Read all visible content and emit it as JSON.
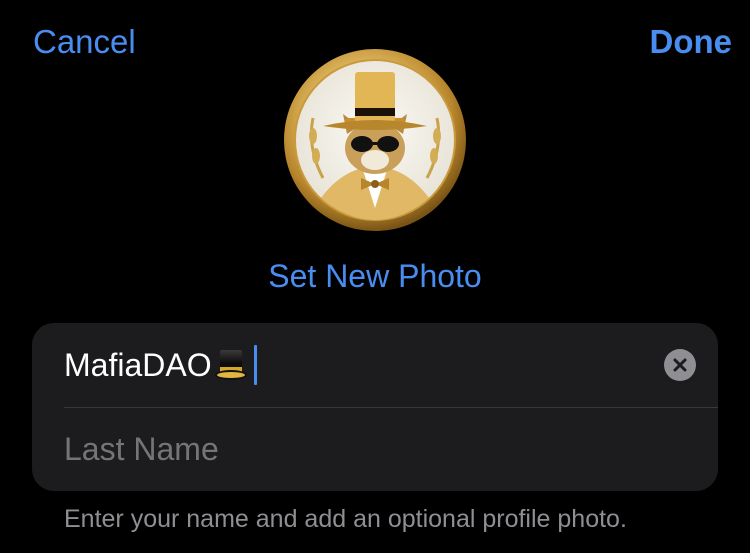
{
  "nav": {
    "cancel_label": "Cancel",
    "done_label": "Done"
  },
  "avatar": {
    "icon": "avatar-cat-coin-icon"
  },
  "set_photo_label": "Set New Photo",
  "form": {
    "first_name_value": "MafiaDAO",
    "first_name_emoji": "top-hat-icon",
    "last_name_placeholder": "Last Name",
    "last_name_value": ""
  },
  "hint_text": "Enter your name and add an optional profile photo.",
  "colors": {
    "accent": "#4a8df0",
    "background": "#000000",
    "card": "#1c1c1e",
    "secondary_text": "#8e8e93"
  }
}
